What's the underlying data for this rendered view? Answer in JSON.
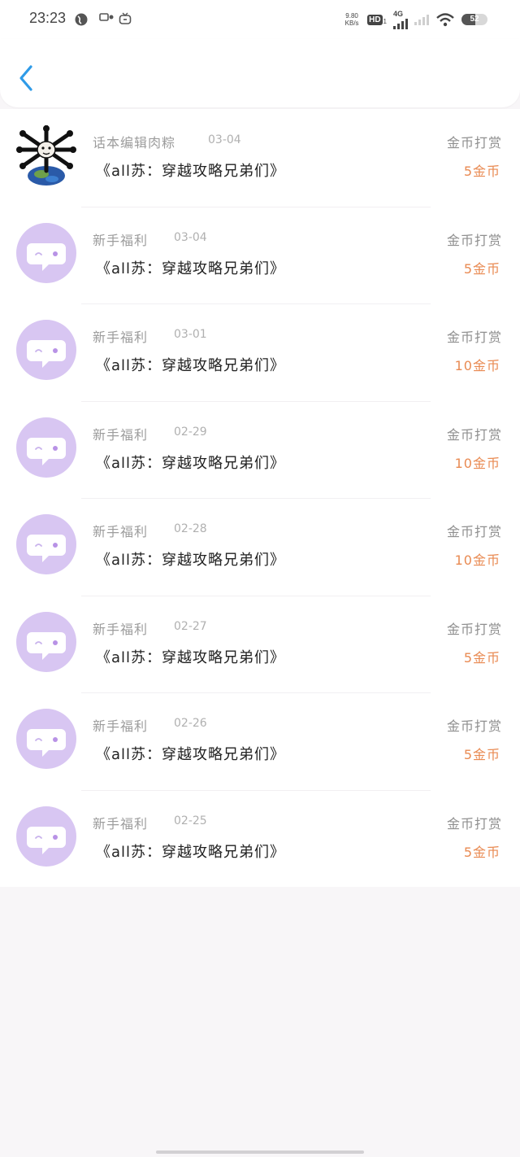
{
  "status_bar": {
    "time": "23:23",
    "net_speed_value": "9.80",
    "net_speed_unit": "KB/s",
    "hd_label": "HD",
    "hd_sub": "1",
    "network_label": "4G",
    "battery_level": "52"
  },
  "header": {
    "back_icon": "chevron-left-icon",
    "accent_color": "#2f9be8"
  },
  "colors": {
    "reward_amount": "#e98a52",
    "avatar_purple": "#d8c6f2"
  },
  "list": {
    "items": [
      {
        "sender": "话本编辑肉粽",
        "date": "03-04",
        "book": "《all苏：穿越攻略兄弟们》",
        "reward_type": "金币打赏",
        "reward_amount": "5金币",
        "avatar_icon": "custom-avatar"
      },
      {
        "sender": "新手福利",
        "date": "03-04",
        "book": "《all苏：穿越攻略兄弟们》",
        "reward_type": "金币打赏",
        "reward_amount": "5金币",
        "avatar_icon": "chat-bubble-icon"
      },
      {
        "sender": "新手福利",
        "date": "03-01",
        "book": "《all苏：穿越攻略兄弟们》",
        "reward_type": "金币打赏",
        "reward_amount": "10金币",
        "avatar_icon": "chat-bubble-icon"
      },
      {
        "sender": "新手福利",
        "date": "02-29",
        "book": "《all苏：穿越攻略兄弟们》",
        "reward_type": "金币打赏",
        "reward_amount": "10金币",
        "avatar_icon": "chat-bubble-icon"
      },
      {
        "sender": "新手福利",
        "date": "02-28",
        "book": "《all苏：穿越攻略兄弟们》",
        "reward_type": "金币打赏",
        "reward_amount": "10金币",
        "avatar_icon": "chat-bubble-icon"
      },
      {
        "sender": "新手福利",
        "date": "02-27",
        "book": "《all苏：穿越攻略兄弟们》",
        "reward_type": "金币打赏",
        "reward_amount": "5金币",
        "avatar_icon": "chat-bubble-icon"
      },
      {
        "sender": "新手福利",
        "date": "02-26",
        "book": "《all苏：穿越攻略兄弟们》",
        "reward_type": "金币打赏",
        "reward_amount": "5金币",
        "avatar_icon": "chat-bubble-icon"
      },
      {
        "sender": "新手福利",
        "date": "02-25",
        "book": "《all苏：穿越攻略兄弟们》",
        "reward_type": "金币打赏",
        "reward_amount": "5金币",
        "avatar_icon": "chat-bubble-icon"
      }
    ]
  }
}
